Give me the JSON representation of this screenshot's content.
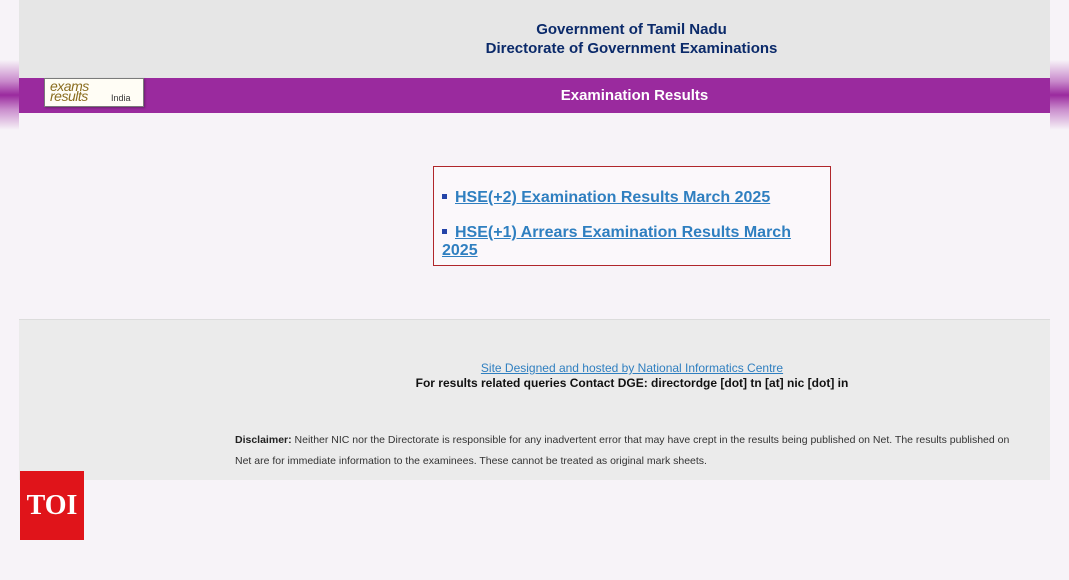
{
  "header": {
    "line1": "Government of Tamil Nadu",
    "line2": "Directorate of Government Examinations"
  },
  "logo": {
    "word1": "exams",
    "word2": "results",
    "word3": "India"
  },
  "bar": {
    "title": "Examination Results"
  },
  "results": {
    "links": [
      {
        "label": "HSE(+2) Examination Results March 2025"
      },
      {
        "label": "HSE(+1) Arrears Examination Results March 2025"
      }
    ]
  },
  "footer": {
    "site_link": "Site Designed and hosted by National Informatics Centre",
    "contact": "For results related queries Contact DGE:  directordge [dot] tn [at] nic [dot] in",
    "disclaimer_label": "Disclaimer:",
    "disclaimer_text": " Neither NIC nor the Directorate is responsible for any inadvertent error that may have crept in the results being published on Net. The results published on Net are for immediate information to the examinees. These cannot be treated as original mark sheets."
  },
  "watermark": {
    "text": "TOI"
  },
  "colors": {
    "bar": "#9a2a9e",
    "header_text": "#0b2a6a",
    "link": "#2f7fc0",
    "box_border": "#b0262b",
    "watermark_bg": "#e0141a"
  }
}
